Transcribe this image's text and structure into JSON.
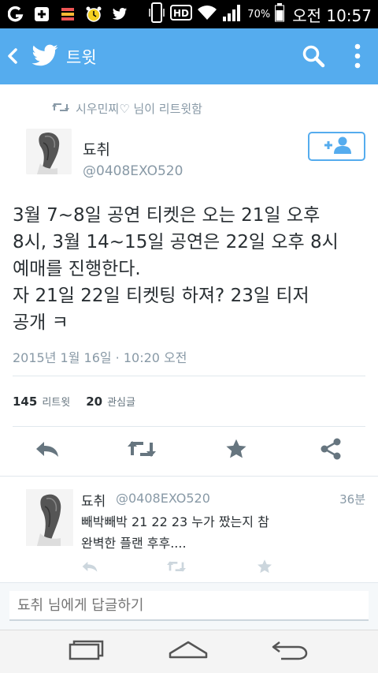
{
  "status_bar": {
    "battery_text": "70%",
    "time": "오전 10:57"
  },
  "app_bar": {
    "title": "트윗",
    "icons": [
      "back-icon",
      "twitter-logo-icon",
      "search-icon",
      "more-icon"
    ]
  },
  "retweet": {
    "label": "시우민찌♡ 님이 리트윗함"
  },
  "tweet": {
    "author_name": "됴취",
    "author_handle": "@0408EXO520",
    "text_lines": [
      "3월 7~8일 공연 티켓은 오는 21일 오후",
      "8시, 3월 14~15일 공연은 22일 오후 8시",
      "예매를 진행한다.",
      "자 21일 22일 티켓팅 하져? 23일 티저",
      "공개 ㅋ"
    ],
    "timestamp": "2015년 1월 16일 · 10:20 오전",
    "retweets_count": "145",
    "retweets_label": "리트윗",
    "favorites_count": "20",
    "favorites_label": "관심글"
  },
  "reply": {
    "author_name": "됴취",
    "author_handle": "@0408EXO520",
    "age": "36분",
    "text_lines": [
      "빼박빼박 21 22 23 누가 짰는지 참",
      "완벽한 플랜 후후...."
    ]
  },
  "compose": {
    "placeholder": "됴취 님에게 답글하기"
  },
  "colors": {
    "brand": "#55acee",
    "muted": "#8899a6",
    "text": "#292f33"
  }
}
